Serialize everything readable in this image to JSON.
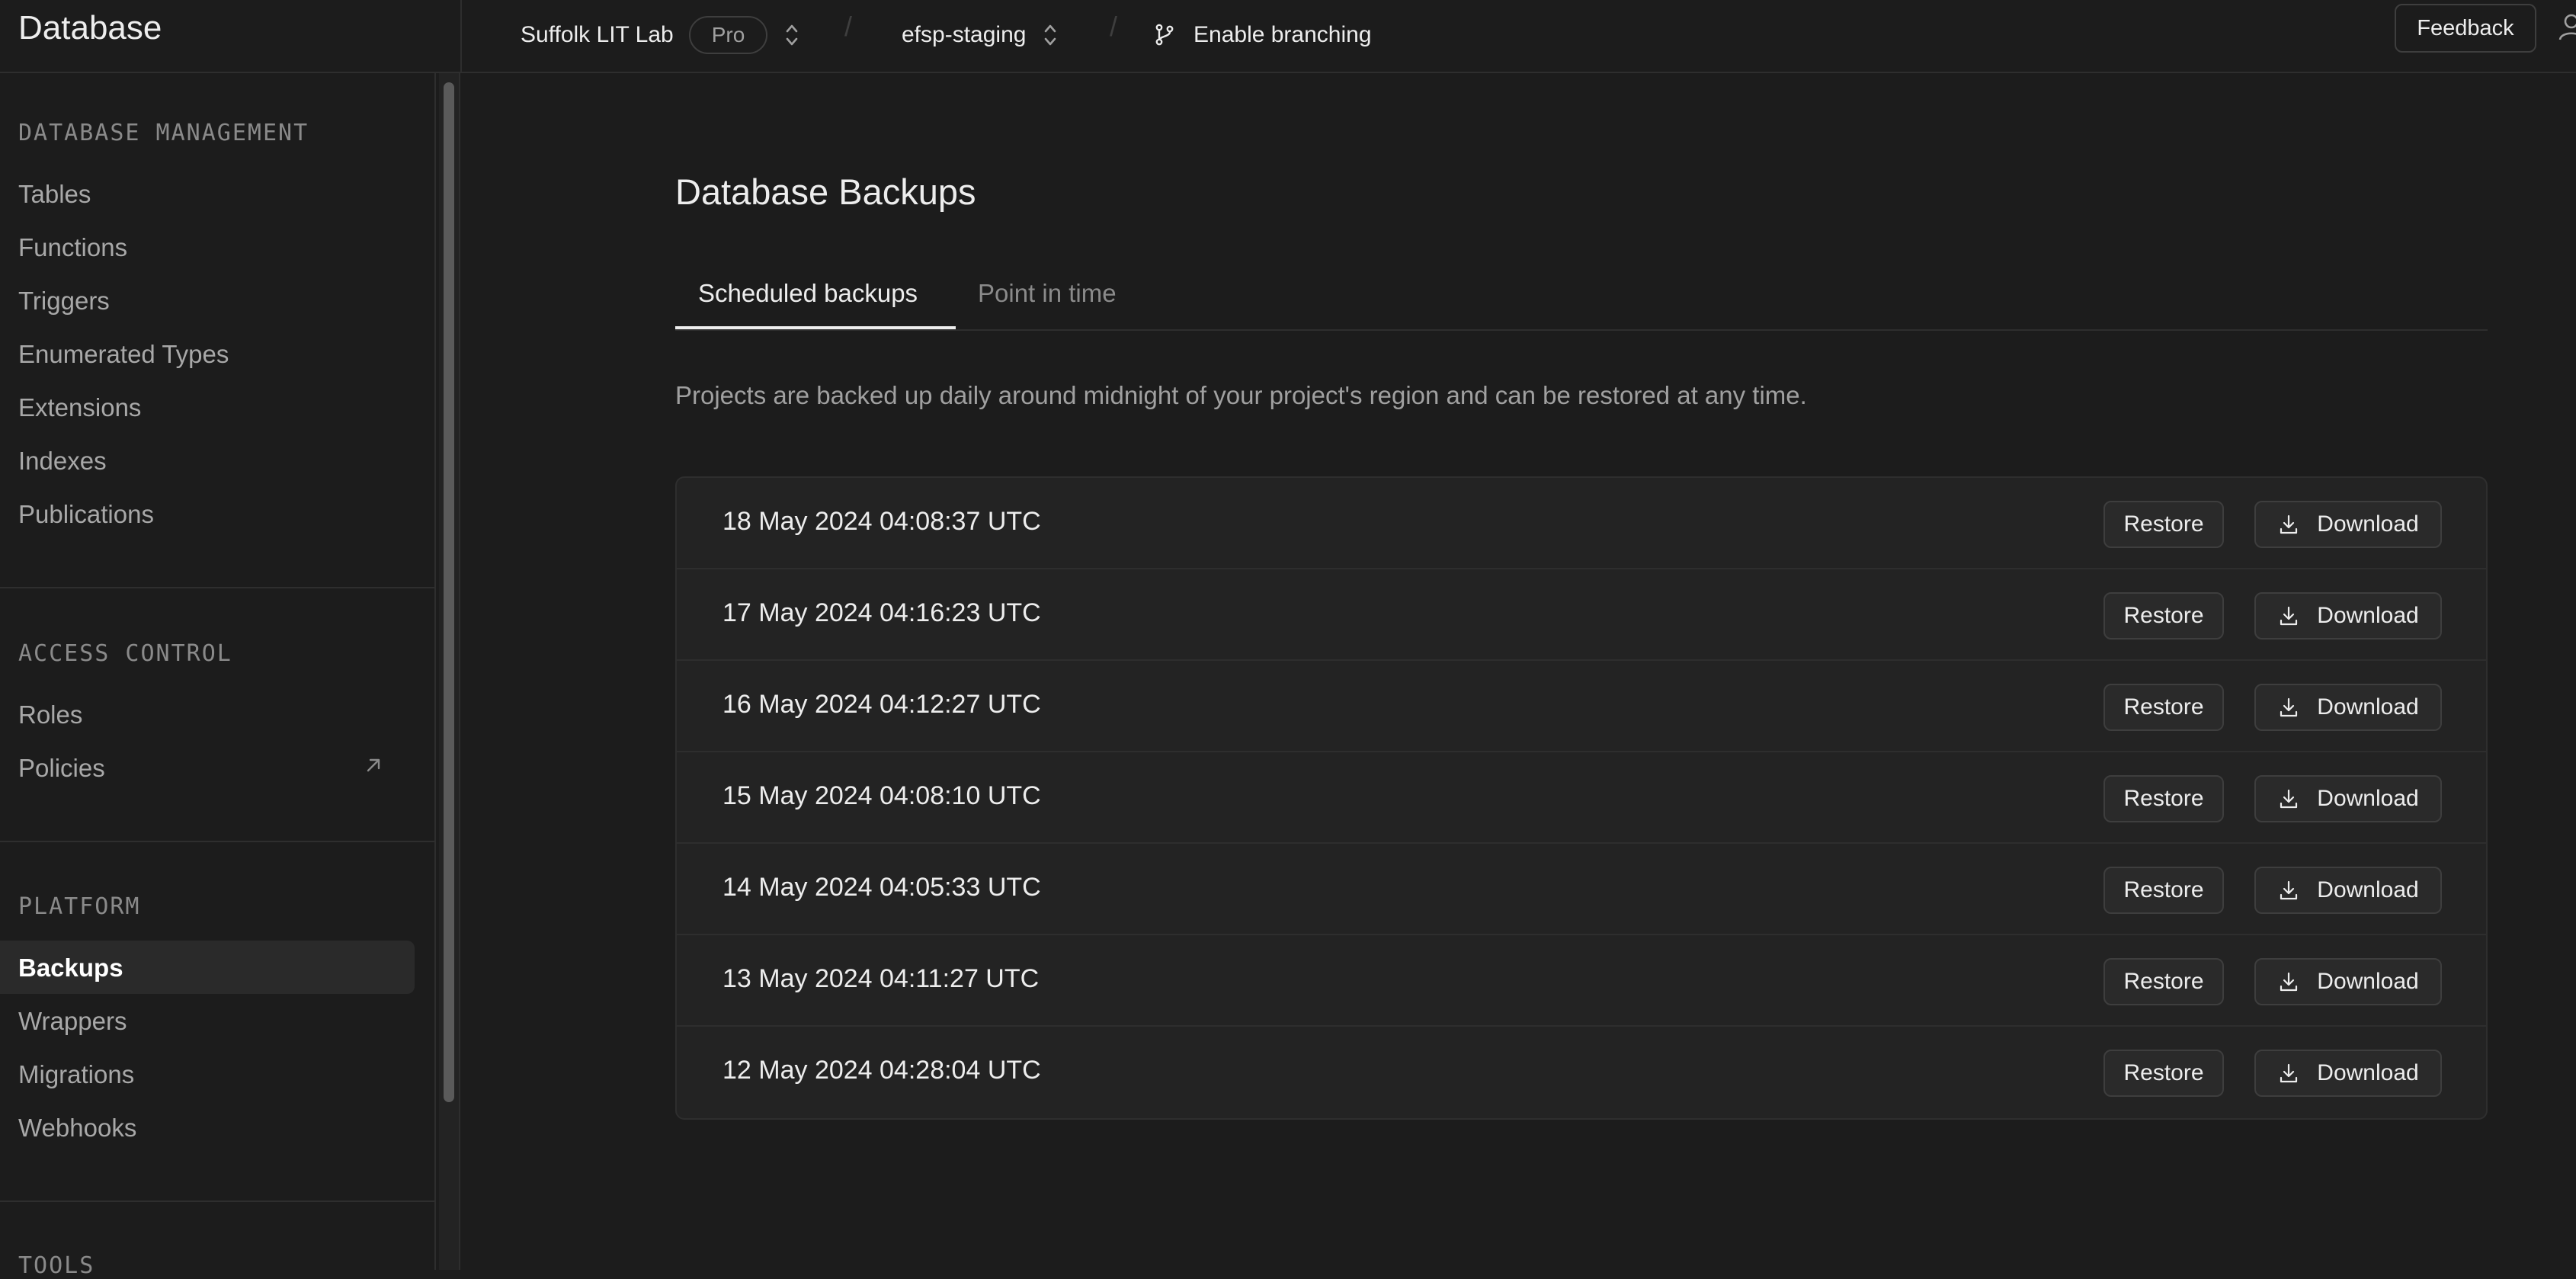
{
  "header": {
    "app_title": "Database",
    "org_name": "Suffolk LIT Lab",
    "plan_badge": "Pro",
    "project_name": "efsp-staging",
    "branching_label": "Enable branching",
    "feedback_label": "Feedback"
  },
  "sidebar": {
    "sections": [
      {
        "title": "DATABASE MANAGEMENT",
        "items": [
          {
            "label": "Tables"
          },
          {
            "label": "Functions"
          },
          {
            "label": "Triggers"
          },
          {
            "label": "Enumerated Types"
          },
          {
            "label": "Extensions"
          },
          {
            "label": "Indexes"
          },
          {
            "label": "Publications"
          }
        ]
      },
      {
        "title": "ACCESS CONTROL",
        "items": [
          {
            "label": "Roles"
          },
          {
            "label": "Policies",
            "icon": "external-link-icon"
          }
        ]
      },
      {
        "title": "PLATFORM",
        "items": [
          {
            "label": "Backups",
            "active": true
          },
          {
            "label": "Wrappers"
          },
          {
            "label": "Migrations"
          },
          {
            "label": "Webhooks"
          }
        ]
      },
      {
        "title": "TOOLS",
        "items": []
      }
    ]
  },
  "main": {
    "title": "Database Backups",
    "tabs": [
      {
        "label": "Scheduled backups",
        "active": true
      },
      {
        "label": "Point in time",
        "active": false
      }
    ],
    "description": "Projects are backed up daily around midnight of your project's region and can be restored at any time.",
    "restore_label": "Restore",
    "download_label": "Download",
    "backups": [
      {
        "timestamp": "18 May 2024 04:08:37 UTC"
      },
      {
        "timestamp": "17 May 2024 04:16:23 UTC"
      },
      {
        "timestamp": "16 May 2024 04:12:27 UTC"
      },
      {
        "timestamp": "15 May 2024 04:08:10 UTC"
      },
      {
        "timestamp": "14 May 2024 04:05:33 UTC"
      },
      {
        "timestamp": "13 May 2024 04:11:27 UTC"
      },
      {
        "timestamp": "12 May 2024 04:28:04 UTC"
      }
    ]
  },
  "colors": {
    "background": "#1c1c1c",
    "panel": "#232323",
    "border": "#2e2e2e",
    "text": "#ededed",
    "muted": "#a0a0a0"
  }
}
